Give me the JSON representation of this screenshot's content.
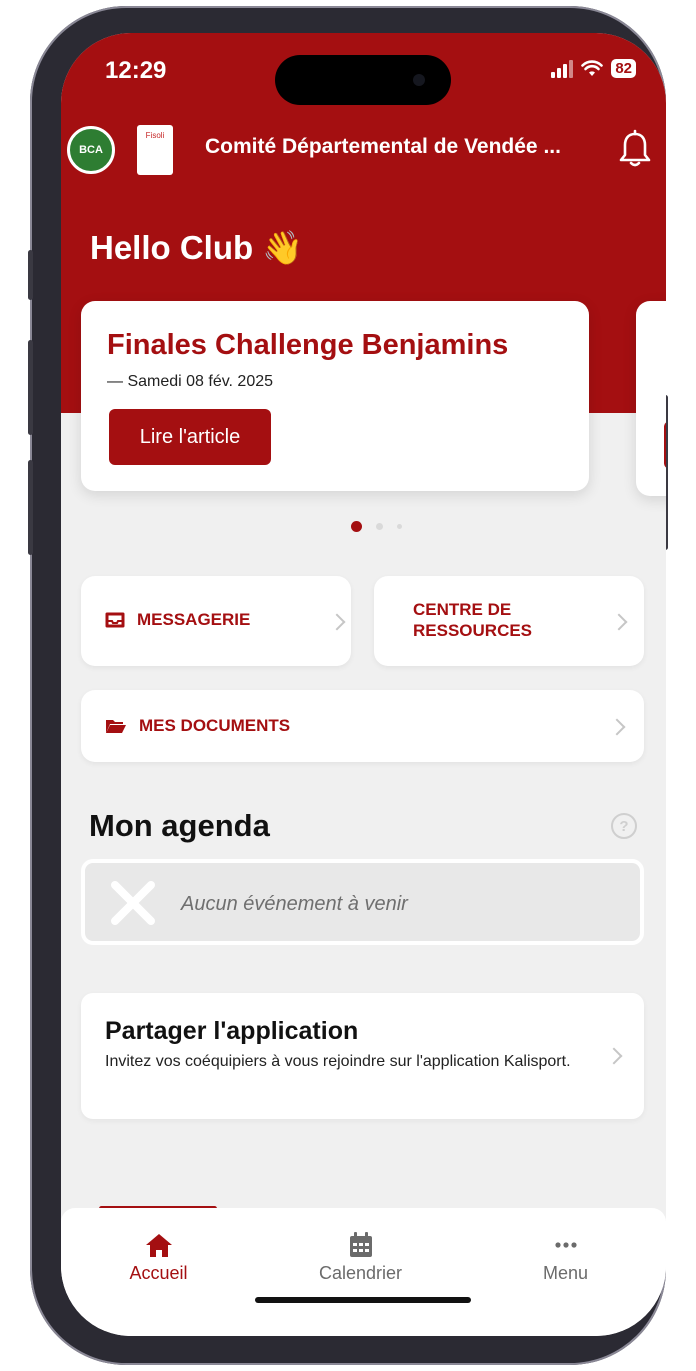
{
  "status_bar": {
    "time": "12:29",
    "battery": "82"
  },
  "header": {
    "logo_left_text": "BCA",
    "logo_right_text": "Fisoli",
    "title": "Comité Départemental de Vendée ..."
  },
  "greeting": "Hello Club 👋",
  "carousel": {
    "cards": [
      {
        "title": "Finales Challenge Benjamins",
        "date": "— Samedi 08 fév. 2025",
        "button": "Lire l'article"
      }
    ],
    "page_count": 3,
    "active_index": 0
  },
  "tiles": {
    "messagerie": "MESSAGERIE",
    "centre_line1": "CENTRE DE",
    "centre_line2": "RESSOURCES",
    "documents": "MES DOCUMENTS"
  },
  "agenda": {
    "title": "Mon agenda",
    "help": "?",
    "empty_text": "Aucun événement à venir"
  },
  "share": {
    "title": "Partager l'application",
    "description": "Invitez vos coéquipiers à vous rejoindre sur l'application Kalisport."
  },
  "tabbar": {
    "items": [
      {
        "label": "Accueil",
        "icon": "home-icon",
        "active": true
      },
      {
        "label": "Calendrier",
        "icon": "calendar-icon",
        "active": false
      },
      {
        "label": "Menu",
        "icon": "more-icon",
        "active": false
      }
    ]
  },
  "colors": {
    "brand": "#a40f11",
    "background": "#f0f0f0"
  }
}
